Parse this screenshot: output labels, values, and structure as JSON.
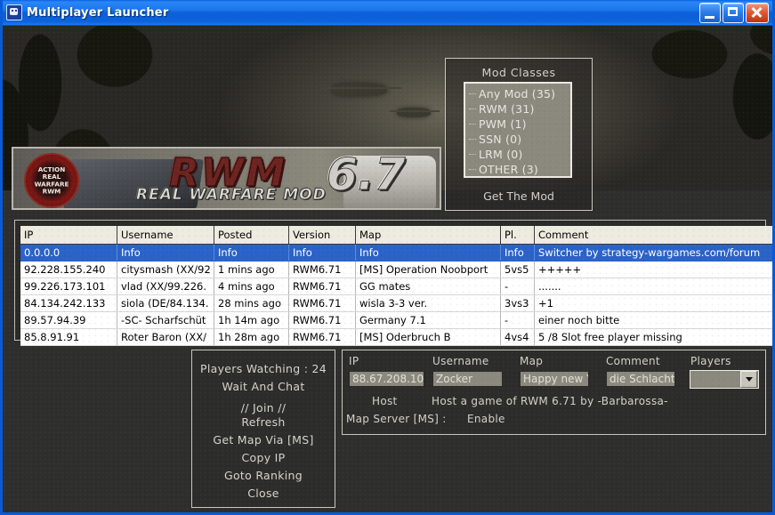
{
  "window": {
    "title": "Multiplayer Launcher",
    "icon": "app-icon",
    "controls": {
      "minimize": "minimize-button",
      "maximize": "maximize-button",
      "close": "close-button"
    }
  },
  "banner": {
    "logo_main": "RWM",
    "logo_version": "6.7",
    "logo_subtitle": "REAL WARFARE MOD",
    "logo_badge": "ACTION REAL WARFARE RWM"
  },
  "mod_classes": {
    "title": "Mod Classes",
    "items": [
      {
        "label": "Any Mod (35)"
      },
      {
        "label": "RWM (31)"
      },
      {
        "label": "PWM (1)"
      },
      {
        "label": "SSN (0)"
      },
      {
        "label": "LRM (0)"
      },
      {
        "label": "OTHER (3)"
      }
    ],
    "get_the_mod": "Get The Mod"
  },
  "server_table": {
    "columns": [
      "IP",
      "Username",
      "Posted",
      "Version",
      "Map",
      "Pl.",
      "Comment"
    ],
    "rows": [
      {
        "selected": true,
        "ip": "0.0.0.0",
        "username": "Info",
        "posted": "Info",
        "version": "Info",
        "map": "Info",
        "pl": "Info",
        "comment": "Switcher by strategy-wargames.com/forum"
      },
      {
        "selected": false,
        "ip": "92.228.155.240",
        "username": "citysmash (XX/92",
        "posted": "1 mins ago",
        "version": "RWM6.71",
        "map": "[MS] Operation Noobport",
        "pl": "5vs5",
        "comment": "+++++"
      },
      {
        "selected": false,
        "ip": "99.226.173.101",
        "username": "vlad (XX/99.226.",
        "posted": "4 mins ago",
        "version": "RWM6.71",
        "map": "GG mates",
        "pl": "-",
        "comment": "......."
      },
      {
        "selected": false,
        "ip": "84.134.242.133",
        "username": "siola (DE/84.134.",
        "posted": "28 mins ago",
        "version": "RWM6.71",
        "map": "wisla 3-3 ver.",
        "pl": "3vs3",
        "comment": "+1"
      },
      {
        "selected": false,
        "ip": "89.57.94.39",
        "username": "-SC- Scharfschüt",
        "posted": "1h 14m ago",
        "version": "RWM6.71",
        "map": "Germany 7.1",
        "pl": "-",
        "comment": "einer noch bitte"
      },
      {
        "selected": false,
        "ip": "85.8.91.91",
        "username": "Roter Baron (XX/",
        "posted": "1h 28m ago",
        "version": "RWM6.71",
        "map": "[MS] Oderbruch B",
        "pl": "4vs4",
        "comment": "5 /8 Slot free  player missing"
      }
    ]
  },
  "menu": {
    "players_watching": "Players Watching : 24",
    "wait_and_chat": "Wait And Chat",
    "join": "// Join //",
    "refresh": "Refresh",
    "get_map": "Get Map Via [MS]",
    "copy_ip": "Copy IP",
    "goto_ranking": "Goto Ranking",
    "close": "Close"
  },
  "host_form": {
    "labels": {
      "ip": "IP",
      "username": "Username",
      "map": "Map",
      "comment": "Comment",
      "players": "Players"
    },
    "values": {
      "ip": "88.67.208.10",
      "username": "Zocker",
      "map": "Happy new Ye",
      "comment": "die Schlachte",
      "players": ""
    },
    "host_button": "Host",
    "host_description": "Host a game of RWM 6.71 by -Barbarossa-",
    "map_server_label": "Map Server [MS] :",
    "map_server_value": "Enable"
  },
  "colors": {
    "titlebar_blue": "#1a76ec",
    "selection_blue": "#2a62c8",
    "panel_text": "#d4d2c9",
    "field_bg": "#8b897d",
    "background": "#2e2e2d"
  }
}
